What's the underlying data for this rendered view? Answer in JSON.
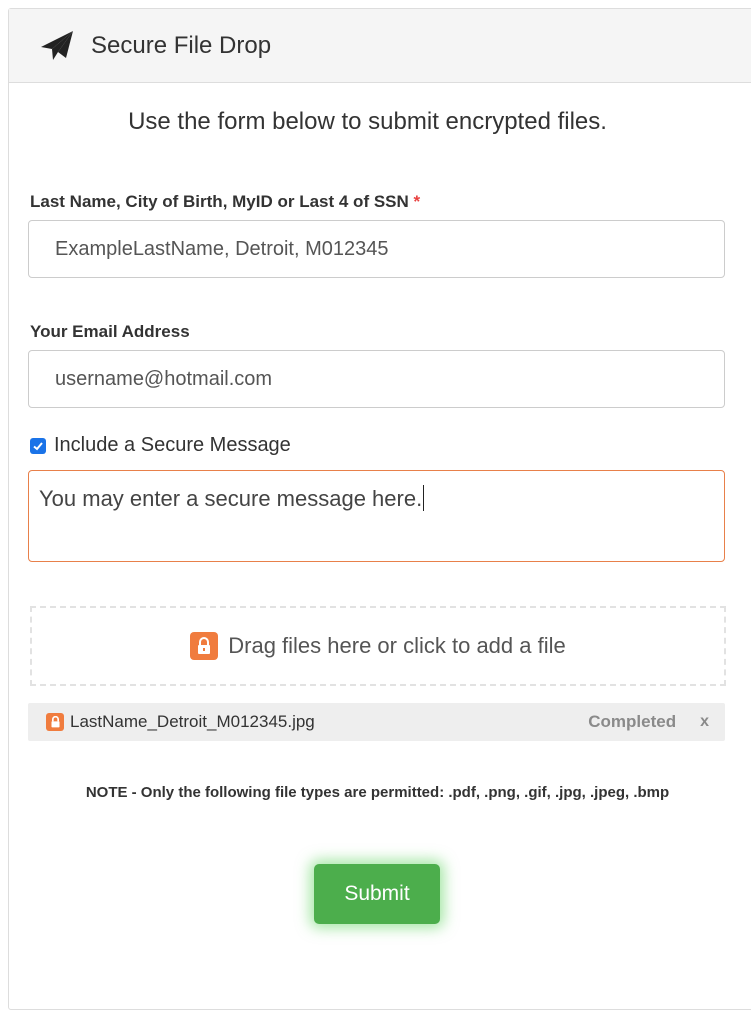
{
  "header": {
    "title": "Secure File Drop",
    "icon": "paper-plane-icon"
  },
  "intro": "Use the form below to submit encrypted files.",
  "identity_field": {
    "label": "Last Name, City of Birth, MyID or Last 4 of SSN",
    "required_mark": "*",
    "value": "ExampleLastName, Detroit, M012345"
  },
  "email_field": {
    "label": "Your Email Address",
    "value": "username@hotmail.com"
  },
  "secure_message": {
    "checkbox_label": "Include a Secure Message",
    "checked": true,
    "text": "You may enter a secure message here."
  },
  "dropzone": {
    "text": "Drag files here or click to add a file",
    "icon": "lock-icon"
  },
  "files": [
    {
      "name": "LastName_Detroit_M012345.jpg",
      "status": "Completed",
      "remove": "x"
    }
  ],
  "note": "NOTE - Only the following file types are permitted: .pdf, .png, .gif, .jpg, .jpeg, .bmp",
  "submit_label": "Submit",
  "colors": {
    "accent_orange": "#f07c3e",
    "submit_green": "#4cae4c",
    "checkbox_blue": "#1a73e8",
    "required_red": "#e8403f"
  }
}
